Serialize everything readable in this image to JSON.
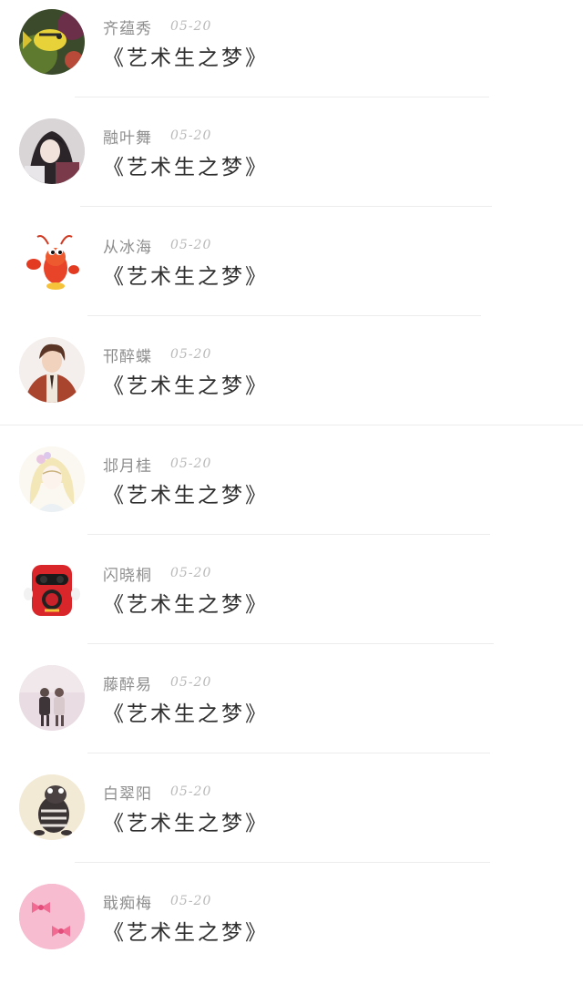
{
  "comments": [
    {
      "name": "齐蕴秀",
      "date": "05-20",
      "text": "《艺术生之梦》",
      "avatar": "tropical-fish-avatar"
    },
    {
      "name": "融叶舞",
      "date": "05-20",
      "text": "《艺术生之梦》",
      "avatar": "anime-girl-avatar"
    },
    {
      "name": "从冰海",
      "date": "05-20",
      "text": "《艺术生之梦》",
      "avatar": "cartoon-lobster-avatar"
    },
    {
      "name": "邗醉蝶",
      "date": "05-20",
      "text": "《艺术生之梦》",
      "avatar": "anime-boy-avatar"
    },
    {
      "name": "邶月桂",
      "date": "05-20",
      "text": "《艺术生之梦》",
      "avatar": "sketch-girl-avatar"
    },
    {
      "name": "闪晓桐",
      "date": "05-20",
      "text": "《艺术生之梦》",
      "avatar": "red-cartoon-avatar"
    },
    {
      "name": "藤醉易",
      "date": "05-20",
      "text": "《艺术生之梦》",
      "avatar": "photo-couple-avatar"
    },
    {
      "name": "白翠阳",
      "date": "05-20",
      "text": "《艺术生之梦》",
      "avatar": "cartoon-animal-avatar"
    },
    {
      "name": "戢痴梅",
      "date": "05-20",
      "text": "《艺术生之梦》",
      "avatar": "pink-bows-avatar"
    }
  ]
}
